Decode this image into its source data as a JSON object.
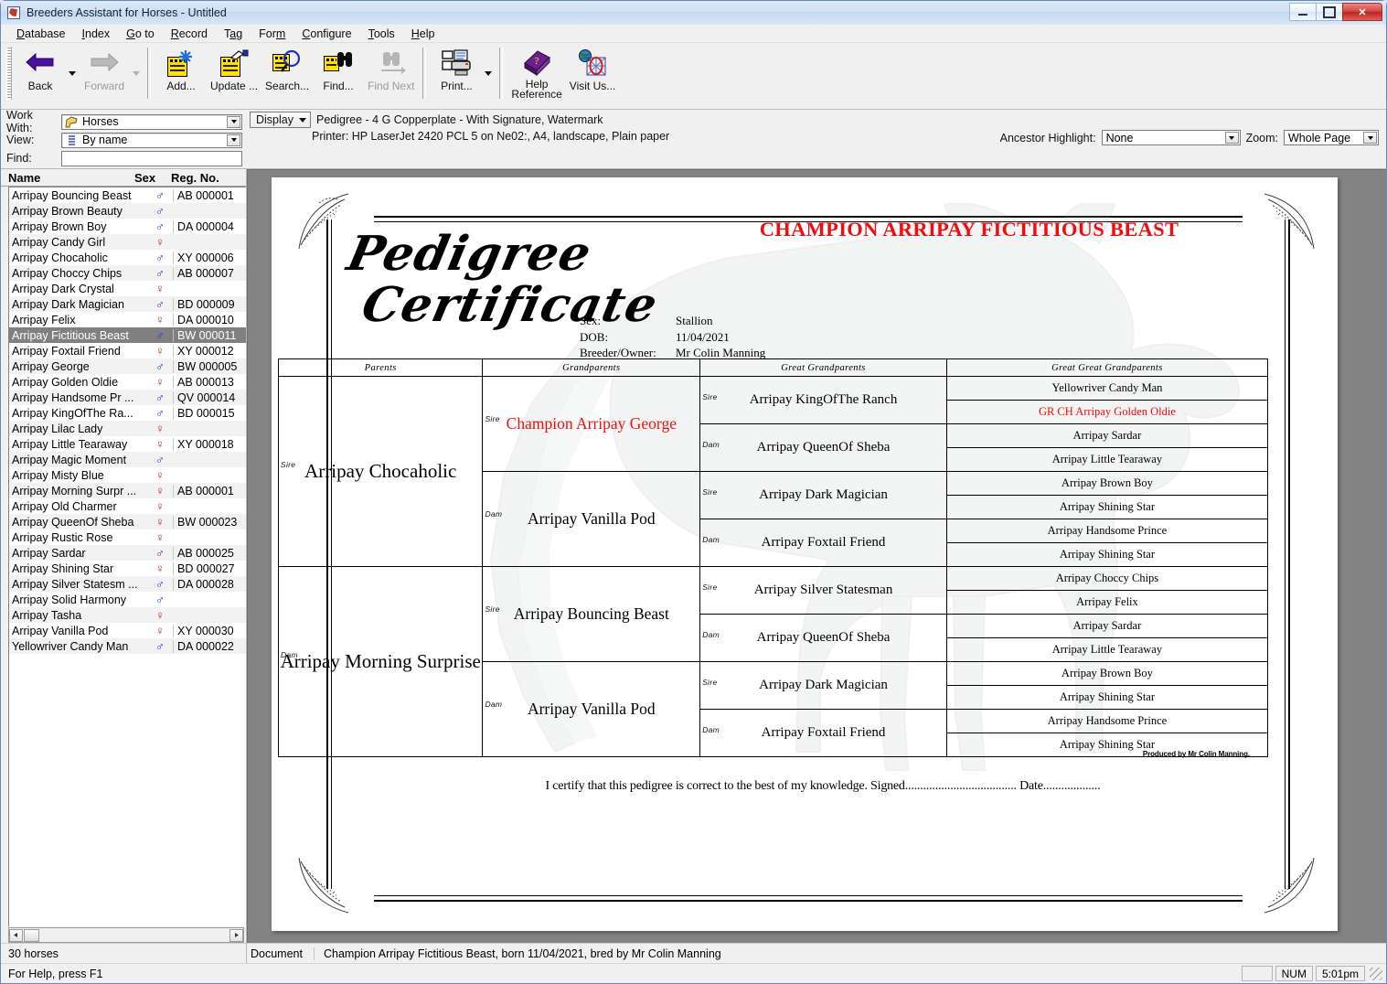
{
  "window": {
    "title": "Breeders Assistant for Horses - Untitled",
    "icon": "app-horse-icon",
    "buttons": {
      "minimize": "–",
      "maximize": "❐",
      "close": "✕"
    }
  },
  "menu": [
    {
      "label": "Database",
      "accel": "D"
    },
    {
      "label": "Index",
      "accel": "I"
    },
    {
      "label": "Go to",
      "accel": "G"
    },
    {
      "label": "Record",
      "accel": "R"
    },
    {
      "label": "Tag",
      "accel": "a"
    },
    {
      "label": "Form",
      "accel": "m"
    },
    {
      "label": "Configure",
      "accel": "C"
    },
    {
      "label": "Tools",
      "accel": "T"
    },
    {
      "label": "Help",
      "accel": "H"
    }
  ],
  "toolbar": [
    {
      "label": "Back",
      "icon": "back-arrow-icon",
      "disabled": false,
      "dropdown": true
    },
    {
      "label": "Forward",
      "icon": "forward-arrow-icon",
      "disabled": true,
      "dropdown": true
    },
    {
      "label": "Add...",
      "icon": "add-record-icon",
      "disabled": false,
      "dropdown": false
    },
    {
      "label": "Update ...",
      "icon": "update-record-icon",
      "disabled": false,
      "dropdown": false
    },
    {
      "label": "Search...",
      "icon": "search-magnifier-icon",
      "disabled": false,
      "dropdown": false
    },
    {
      "label": "Find...",
      "icon": "find-binoculars-icon",
      "disabled": false,
      "dropdown": false
    },
    {
      "label": "Find Next",
      "icon": "find-next-binoculars-icon",
      "disabled": true,
      "dropdown": false
    },
    {
      "label": "Print...",
      "icon": "printer-icon",
      "disabled": false,
      "dropdown": true
    },
    {
      "label": "Help Reference",
      "icon": "help-book-icon",
      "disabled": false,
      "dropdown": false
    },
    {
      "label": "Visit Us...",
      "icon": "globe-visit-icon",
      "disabled": false,
      "dropdown": false
    }
  ],
  "sidebar": {
    "work_with_label": "Work With:",
    "work_with_value": "Horses",
    "view_label": "View:",
    "view_value": "By name",
    "find_label": "Find:",
    "find_value": "",
    "columns": {
      "name": "Name",
      "sex": "Sex",
      "reg": "Reg. No."
    },
    "count": "30 horses",
    "rows": [
      {
        "name": "Arripay Bouncing Beast",
        "sex": "male",
        "reg": "AB 000001",
        "selected": false
      },
      {
        "name": "Arripay Brown Beauty",
        "sex": "male",
        "reg": "",
        "selected": false
      },
      {
        "name": "Arripay Brown Boy",
        "sex": "male",
        "reg": "DA 000004",
        "selected": false
      },
      {
        "name": "Arripay Candy Girl",
        "sex": "female",
        "reg": "",
        "selected": false
      },
      {
        "name": "Arripay Chocaholic",
        "sex": "male",
        "reg": "XY 000006",
        "selected": false
      },
      {
        "name": "Arripay Choccy Chips",
        "sex": "male",
        "reg": "AB 000007",
        "selected": false
      },
      {
        "name": "Arripay Dark Crystal",
        "sex": "female",
        "reg": "",
        "selected": false
      },
      {
        "name": "Arripay Dark Magician",
        "sex": "male",
        "reg": "BD 000009",
        "selected": false
      },
      {
        "name": "Arripay Felix",
        "sex": "female",
        "reg": "DA 000010",
        "selected": false
      },
      {
        "name": "Arripay Fictitious Beast",
        "sex": "male",
        "reg": "BW 000011",
        "selected": true
      },
      {
        "name": "Arripay Foxtail Friend",
        "sex": "female",
        "reg": "XY 000012",
        "selected": false
      },
      {
        "name": "Arripay George",
        "sex": "male",
        "reg": "BW 000005",
        "selected": false
      },
      {
        "name": "Arripay Golden Oldie",
        "sex": "female",
        "reg": "AB 000013",
        "selected": false
      },
      {
        "name": "Arripay Handsome Pr ...",
        "sex": "male",
        "reg": "QV 000014",
        "selected": false
      },
      {
        "name": "Arripay KingOfThe Ra...",
        "sex": "male",
        "reg": "BD 000015",
        "selected": false
      },
      {
        "name": "Arripay Lilac Lady",
        "sex": "female",
        "reg": "",
        "selected": false
      },
      {
        "name": "Arripay Little Tearaway",
        "sex": "female",
        "reg": "XY 000018",
        "selected": false
      },
      {
        "name": "Arripay Magic Moment",
        "sex": "male",
        "reg": "",
        "selected": false
      },
      {
        "name": "Arripay Misty Blue",
        "sex": "female",
        "reg": "",
        "selected": false
      },
      {
        "name": "Arripay Morning Surpr ...",
        "sex": "female",
        "reg": "AB 000001",
        "selected": false
      },
      {
        "name": "Arripay Old Charmer",
        "sex": "female",
        "reg": "",
        "selected": false
      },
      {
        "name": "Arripay QueenOf Sheba",
        "sex": "female",
        "reg": "BW 000023",
        "selected": false
      },
      {
        "name": "Arripay Rustic Rose",
        "sex": "female",
        "reg": "",
        "selected": false
      },
      {
        "name": "Arripay Sardar",
        "sex": "male",
        "reg": "AB 000025",
        "selected": false
      },
      {
        "name": "Arripay Shining Star",
        "sex": "female",
        "reg": "BD 000027",
        "selected": false
      },
      {
        "name": "Arripay Silver Statesm ...",
        "sex": "male",
        "reg": "DA 000028",
        "selected": false
      },
      {
        "name": "Arripay Solid Harmony",
        "sex": "male",
        "reg": "",
        "selected": false
      },
      {
        "name": "Arripay Tasha",
        "sex": "female",
        "reg": "",
        "selected": false
      },
      {
        "name": "Arripay Vanilla Pod",
        "sex": "female",
        "reg": "XY 000030",
        "selected": false
      },
      {
        "name": "Yellowriver Candy Man",
        "sex": "male",
        "reg": "DA 000022",
        "selected": false
      }
    ]
  },
  "docbar": {
    "display_button": "Display",
    "form_name": "Pedigree - 4 G Copperplate - With Signature, Watermark",
    "printer_line": "Printer: HP LaserJet 2420 PCL 5 on Ne02:, A4, landscape, Plain paper",
    "ancestor_highlight_label": "Ancestor Highlight:",
    "ancestor_highlight_value": "None",
    "zoom_label": "Zoom:",
    "zoom_value": "Whole Page"
  },
  "certificate": {
    "script_line1": "Pedigree",
    "script_line2": "Certificate",
    "champion_title": "CHAMPION ARRIPAY FICTITIOUS BEAST",
    "details": [
      {
        "key": "Sex:",
        "value": "Stallion"
      },
      {
        "key": "DOB:",
        "value": "11/04/2021"
      },
      {
        "key": "Breeder/Owner:",
        "value": "Mr Colin Manning"
      }
    ],
    "headers": [
      "Parents",
      "Grandparents",
      "Great Grandparents",
      "Great Great Grandparents"
    ],
    "sire_label": "Sire",
    "dam_label": "Dam",
    "parents": [
      {
        "role": "Sire",
        "name": "Arripay Chocaholic",
        "red": false
      },
      {
        "role": "Dam",
        "name": "Arripay Morning Surprise",
        "red": false
      }
    ],
    "grandparents": [
      {
        "role": "Sire",
        "name": "Champion Arripay George",
        "red": true
      },
      {
        "role": "Dam",
        "name": "Arripay Vanilla Pod",
        "red": false
      },
      {
        "role": "Sire",
        "name": "Arripay Bouncing Beast",
        "red": false
      },
      {
        "role": "Dam",
        "name": "Arripay Vanilla Pod",
        "red": false
      }
    ],
    "great_grandparents": [
      {
        "role": "Sire",
        "name": "Arripay KingOfThe Ranch",
        "red": false
      },
      {
        "role": "Dam",
        "name": "Arripay QueenOf Sheba",
        "red": false
      },
      {
        "role": "Sire",
        "name": "Arripay Dark Magician",
        "red": false
      },
      {
        "role": "Dam",
        "name": "Arripay Foxtail Friend",
        "red": false
      },
      {
        "role": "Sire",
        "name": "Arripay Silver Statesman",
        "red": false
      },
      {
        "role": "Dam",
        "name": "Arripay QueenOf Sheba",
        "red": false
      },
      {
        "role": "Sire",
        "name": "Arripay Dark Magician",
        "red": false
      },
      {
        "role": "Dam",
        "name": "Arripay Foxtail Friend",
        "red": false
      }
    ],
    "great_great_grandparents": [
      {
        "name": "Yellowriver Candy Man",
        "red": false
      },
      {
        "name": "GR CH Arripay Golden Oldie",
        "red": true
      },
      {
        "name": "Arripay Sardar",
        "red": false
      },
      {
        "name": "Arripay Little Tearaway",
        "red": false
      },
      {
        "name": "Arripay Brown Boy",
        "red": false
      },
      {
        "name": "Arripay Shining Star",
        "red": false
      },
      {
        "name": "Arripay Handsome Prince",
        "red": false
      },
      {
        "name": "Arripay Shining Star",
        "red": false
      },
      {
        "name": "Arripay Choccy Chips",
        "red": false
      },
      {
        "name": "Arripay Felix",
        "red": false
      },
      {
        "name": "Arripay Sardar",
        "red": false
      },
      {
        "name": "Arripay Little Tearaway",
        "red": false
      },
      {
        "name": "Arripay Brown Boy",
        "red": false
      },
      {
        "name": "Arripay Shining Star",
        "red": false
      },
      {
        "name": "Arripay Handsome Prince",
        "red": false
      },
      {
        "name": "Arripay Shining Star",
        "red": false
      }
    ],
    "certify_line": "I certify that this pedigree is correct to the best of my knowledge. Signed..................................... Date...................",
    "produced_by": "Produced by Mr Colin Manning."
  },
  "docstatus": {
    "label": "Document",
    "text": "Champion Arripay Fictitious Beast, born 11/04/2021, bred by Mr Colin Manning"
  },
  "statusbar": {
    "help": "For Help, press F1",
    "blank": "",
    "num": "NUM",
    "time": "5:01pm"
  },
  "colors": {
    "red_accent": "#f10d0d",
    "male_blue": "#1c1cd0",
    "female_red": "#d01c1c",
    "selection": "#808080"
  }
}
